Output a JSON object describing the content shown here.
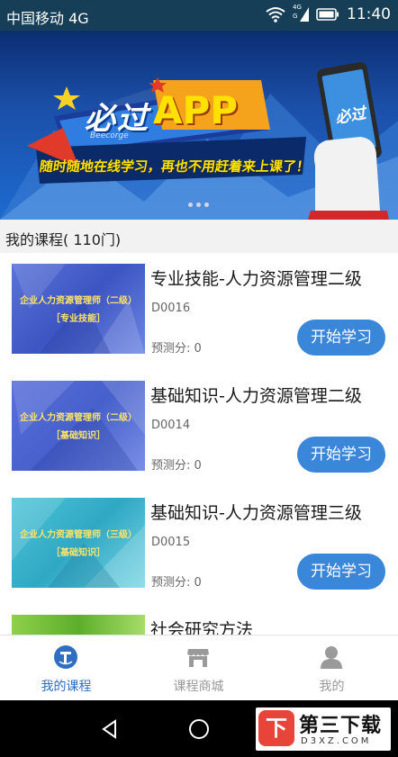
{
  "status_bar": {
    "carrier": "中国移动 4G",
    "network_small_1": "4G",
    "network_small_2": "G",
    "time": "11:40"
  },
  "banner": {
    "title": "必过",
    "app_word": "APP",
    "sub_text": "Beecorge",
    "slogan": "随时随地在线学习，再也不用赶着来上课了！",
    "phone_screen_text": "必过",
    "page_dots": 3
  },
  "section": {
    "title": "我的课程( 110门)"
  },
  "courses": [
    {
      "thumb_line1": "企业人力资源管理师（二级）",
      "thumb_line2": "［专业技能］",
      "title": "专业技能-人力资源管理二级",
      "code": "D0016",
      "score": "预测分: 0",
      "button": "开始学习"
    },
    {
      "thumb_line1": "企业人力资源管理师（二级）",
      "thumb_line2": "［基础知识］",
      "title": "基础知识-人力资源管理二级",
      "code": "D0014",
      "score": "预测分: 0",
      "button": "开始学习"
    },
    {
      "thumb_line1": "企业人力资源管理师（三级）",
      "thumb_line2": "［基础知识］",
      "title": "基础知识-人力资源管理三级",
      "code": "D0015",
      "score": "预测分: 0",
      "button": "开始学习"
    },
    {
      "title": "社会研究方法"
    }
  ],
  "tabs": [
    {
      "label": "我的课程",
      "icon": "course-icon",
      "active": true
    },
    {
      "label": "课程商城",
      "icon": "store-icon",
      "active": false
    },
    {
      "label": "我的",
      "icon": "person-icon",
      "active": false
    }
  ],
  "watermark": {
    "logo_char": "下",
    "name": "第三下载",
    "domain": "D3XZ.COM"
  },
  "colors": {
    "accent": "#3a86d8",
    "active_tab": "#2e6fc2",
    "status_bar": "#163e57"
  }
}
